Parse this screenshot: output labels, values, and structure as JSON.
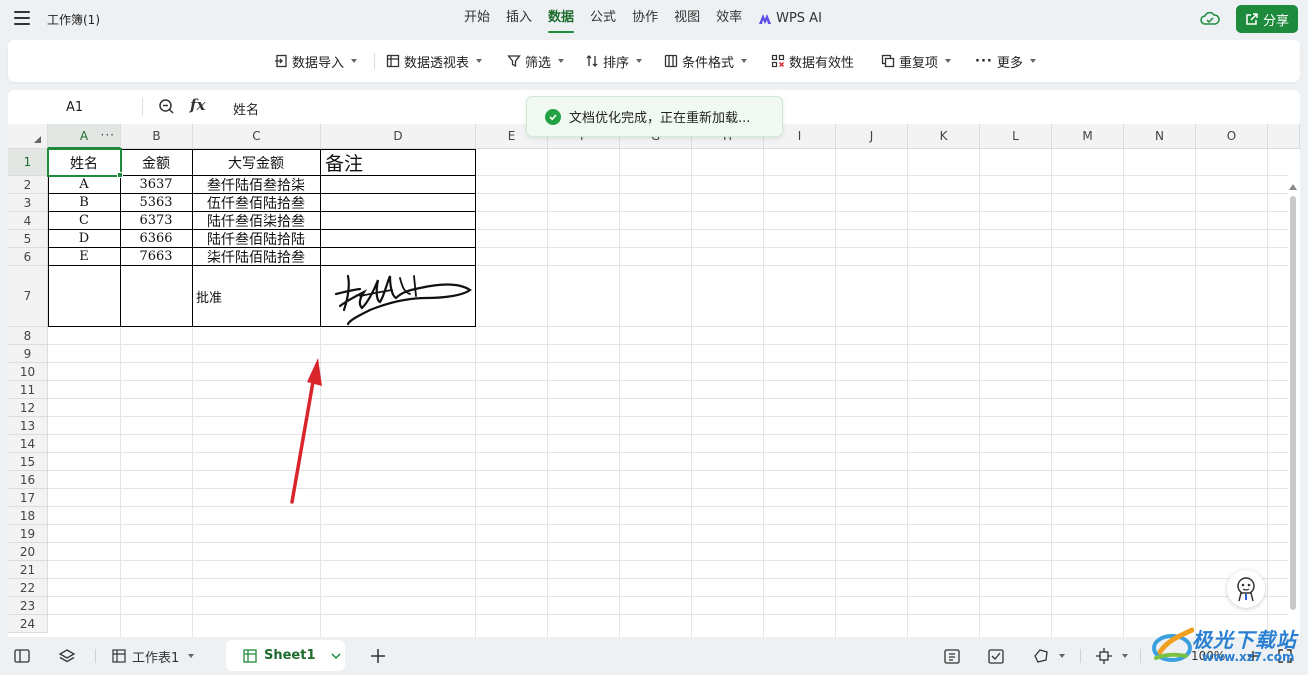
{
  "topbar": {
    "workbook_title": "工作簿(1)",
    "tabs": [
      {
        "label": "开始"
      },
      {
        "label": "插入"
      },
      {
        "label": "数据"
      },
      {
        "label": "公式"
      },
      {
        "label": "协作"
      },
      {
        "label": "视图"
      },
      {
        "label": "效率"
      },
      {
        "label": "WPS AI"
      }
    ],
    "active_tab": "数据",
    "share_label": "分享"
  },
  "ribbon": {
    "data_import": "数据导入",
    "pivot": "数据透视表",
    "filter": "筛选",
    "sort": "排序",
    "conditional_format": "条件格式",
    "validation": "数据有效性",
    "duplicates": "重复项",
    "more": "更多"
  },
  "formula_bar": {
    "cell_ref": "A1",
    "fx": "fx",
    "content": "姓名"
  },
  "toast": {
    "message": "文档优化完成，正在重新加载..."
  },
  "grid": {
    "columns": [
      "A",
      "B",
      "C",
      "D",
      "E",
      "F",
      "G",
      "H",
      "I",
      "J",
      "K",
      "L",
      "M",
      "N",
      "O"
    ],
    "rows": [
      "1",
      "2",
      "3",
      "4",
      "5",
      "6",
      "7",
      "8",
      "9",
      "10",
      "11",
      "12",
      "13",
      "14",
      "15",
      "16",
      "17",
      "18",
      "19",
      "20",
      "21",
      "22",
      "23",
      "24"
    ],
    "headers": {
      "name": "姓名",
      "amount": "金额",
      "uppercase": "大写金额",
      "note": "备注"
    },
    "data_rows": [
      {
        "name": "A",
        "amount": "3637",
        "uppercase": "叁仟陆佰叁拾柒"
      },
      {
        "name": "B",
        "amount": "5363",
        "uppercase": "伍仟叁佰陆拾叁"
      },
      {
        "name": "C",
        "amount": "6373",
        "uppercase": "陆仟叁佰柒拾叁"
      },
      {
        "name": "D",
        "amount": "6366",
        "uppercase": "陆仟叁佰陆拾陆"
      },
      {
        "name": "E",
        "amount": "7663",
        "uppercase": "柒仟陆佰陆拾叁"
      }
    ],
    "approve_label": "批准"
  },
  "bottombar": {
    "sheet_list_label": "工作表1",
    "active_sheet": "Sheet1",
    "zoom": "100%"
  },
  "watermark": {
    "brand": "极光下载站",
    "url": "www.xz7.com"
  },
  "colors": {
    "accent": "#1e8a3c",
    "arrow": "#d9262c"
  }
}
